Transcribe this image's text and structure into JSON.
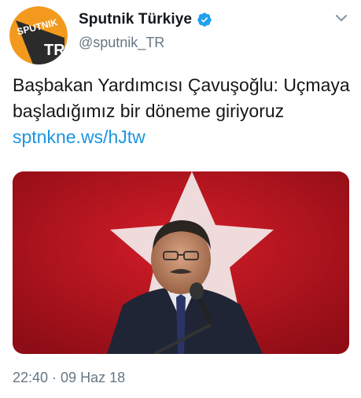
{
  "tweet": {
    "display_name": "Sputnik Türkiye",
    "handle": "@sputnik_TR",
    "text_main": "Başbakan Yardımcısı Çavuşoğlu: Uçmaya başladığımız bir döneme giriyoruz ",
    "link_text": "sptnkne.ws/hJtw",
    "timestamp": "22:40 · 09 Haz 18"
  },
  "avatar": {
    "logo_top": "SPUTNIK",
    "logo_bottom": "TR"
  },
  "icons": {
    "verified": "verified-badge-icon",
    "menu": "chevron-down-icon"
  },
  "colors": {
    "accent": "#1b95e0",
    "secondary_text": "#657786",
    "logo_orange": "#f39a1e",
    "flag_red": "#c0141e"
  }
}
